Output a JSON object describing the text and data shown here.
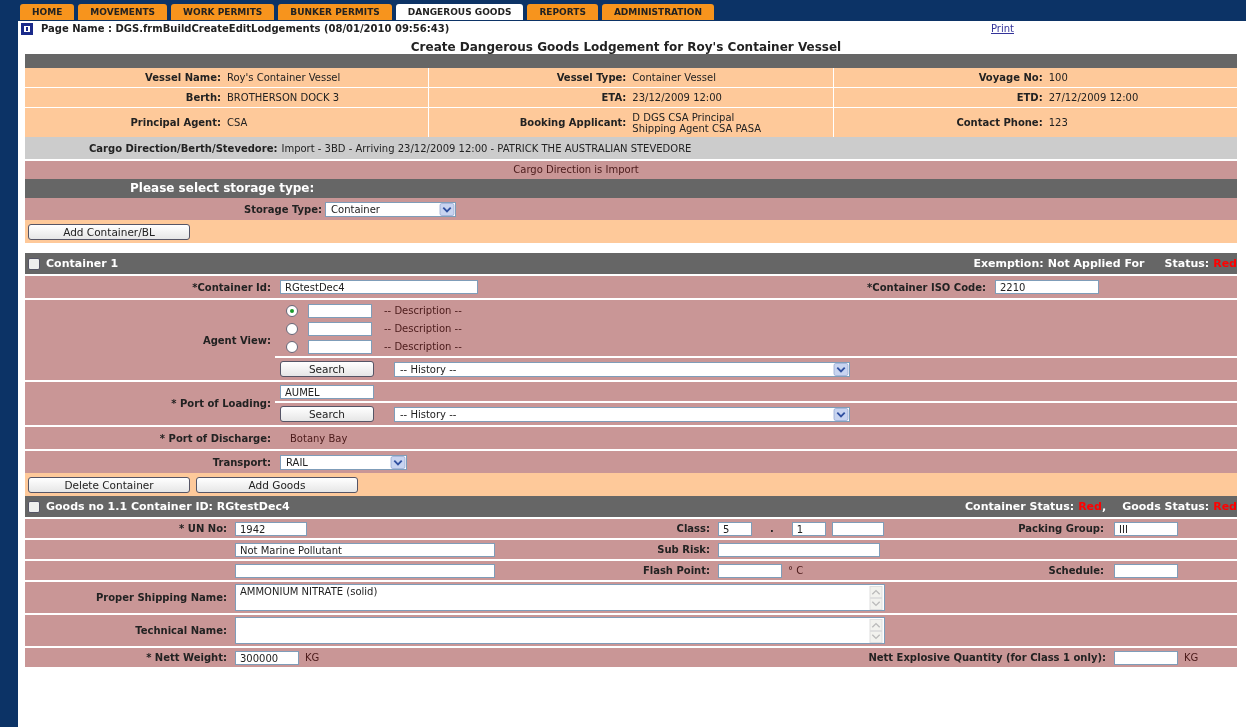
{
  "tabs": [
    {
      "label": "HOME",
      "selected": false
    },
    {
      "label": "MOVEMENTS",
      "selected": false
    },
    {
      "label": "WORK PERMITS",
      "selected": false
    },
    {
      "label": "BUNKER PERMITS",
      "selected": false
    },
    {
      "label": "DANGEROUS GOODS",
      "selected": true
    },
    {
      "label": "REPORTS",
      "selected": false
    },
    {
      "label": "ADMINISTRATION",
      "selected": false
    }
  ],
  "page_name": "Page Name : DGS.frmBuildCreateEditLodgements (08/01/2010 09:56:43)",
  "print_link": "Print",
  "heading": "Create Dangerous Goods Lodgement for Roy's Container Vessel",
  "vessel_info": [
    {
      "cells": [
        {
          "label": "Vessel Name:",
          "value": "Roy's Container Vessel"
        },
        {
          "label": "Vessel Type:",
          "value": "Container Vessel"
        },
        {
          "label": "Voyage No:",
          "value": "100"
        }
      ]
    },
    {
      "cells": [
        {
          "label": "Berth:",
          "value": "BROTHERSON DOCK 3"
        },
        {
          "label": "ETA:",
          "value": "23/12/2009 12:00"
        },
        {
          "label": "ETD:",
          "value": "27/12/2009 12:00"
        }
      ]
    },
    {
      "cells": [
        {
          "label": "Principal Agent:",
          "value": "CSA"
        },
        {
          "label": "Booking Applicant:",
          "value": "D DGS CSA Principal\nShipping Agent CSA PASA"
        },
        {
          "label": "Contact Phone:",
          "value": "123"
        }
      ]
    }
  ],
  "cargo_direction": {
    "label": "Cargo Direction/Berth/Stevedore:",
    "value": "Import - 3BD - Arriving 23/12/2009 12:00 - PATRICK THE AUSTRALIAN STEVEDORE"
  },
  "cargo_message": "Cargo Direction is Import",
  "storage": {
    "heading": "Please select storage type:",
    "label": "Storage Type:",
    "value": "Container"
  },
  "add_container_button": "Add Container/BL",
  "container": {
    "checked": false,
    "title": "Container 1",
    "exemption_label": "Exemption:",
    "exemption_value": "Not Applied For",
    "status_label": "Status:",
    "status_value": "Red",
    "container_id": {
      "label": "*Container Id:",
      "value": "RGtestDec4"
    },
    "iso_code": {
      "label": "*Container ISO Code:",
      "value": "2210"
    },
    "agent_view": {
      "label": "Agent View:",
      "options": [
        {
          "selected": true,
          "description": "-- Description --"
        },
        {
          "selected": false,
          "description": "-- Description --"
        },
        {
          "selected": false,
          "description": "-- Description --"
        }
      ],
      "search_button": "Search",
      "history": "-- History --"
    },
    "port_of_loading": {
      "label": "* Port of Loading:",
      "value": "AUMEL",
      "search_button": "Search",
      "history": "-- History --"
    },
    "port_of_discharge": {
      "label": "* Port of Discharge:",
      "value": "Botany Bay"
    },
    "transport": {
      "label": "Transport:",
      "value": "RAIL"
    },
    "buttons": [
      "Delete Container",
      "Add Goods"
    ]
  },
  "goods": {
    "checked": false,
    "title": "Goods no 1.1 Container ID: RGtestDec4",
    "container_status_label": "Container Status:",
    "container_status_value": "Red",
    "separator": ",",
    "goods_status_label": "Goods Status:",
    "goods_status_value": "Red",
    "un_no": {
      "label": "* UN No:",
      "value": "1942"
    },
    "class": {
      "label": "Class:",
      "values": [
        "5",
        "1"
      ],
      "dot": "."
    },
    "packing_group": {
      "label": "Packing Group:",
      "value": "III"
    },
    "pollutant": "Not Marine Pollutant",
    "sub_risk": {
      "label": "Sub Risk:"
    },
    "flash_point": {
      "label": "Flash Point:",
      "unit": "° C"
    },
    "schedule": {
      "label": "Schedule:"
    },
    "proper_shipping_name": {
      "label": "Proper Shipping Name:",
      "value": "AMMONIUM NITRATE (solid)"
    },
    "technical_name": {
      "label": "Technical Name:"
    },
    "nett_weight": {
      "label": "* Nett Weight:",
      "value": "300000",
      "unit": "KG"
    },
    "nett_explosive": {
      "label": "Nett Explosive Quantity (for Class 1 only):",
      "unit": "KG"
    }
  }
}
